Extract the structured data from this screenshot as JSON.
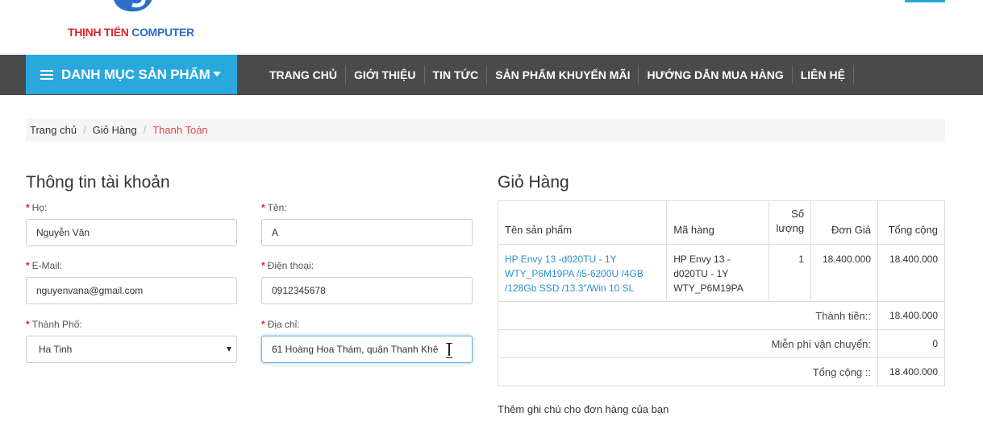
{
  "header": {
    "logo_text_1": "THỊNH TIẾN",
    "logo_text_2": "COMPUTER"
  },
  "nav": {
    "category_label": "DANH MỤC SẢN PHẨM",
    "menu": [
      "TRANG CHỦ",
      "GIỚI THIỆU",
      "TIN TỨC",
      "SẢN PHẨM KHUYẾN MÃI",
      "HƯỚNG DẪN MUA HÀNG",
      "LIÊN HỆ"
    ]
  },
  "breadcrumb": {
    "home": "Trang chủ",
    "cart": "Giỏ Hàng",
    "current": "Thanh Toán"
  },
  "account": {
    "title": "Thông tin tài khoản",
    "required_mark": "*",
    "last_name_label": "Họ:",
    "last_name_value": "Nguyễn Văn",
    "first_name_label": "Tên:",
    "first_name_value": "A",
    "email_label": "E-Mail:",
    "email_value": "nguyenvana@gmail.com",
    "phone_label": "Điện thoại:",
    "phone_value": "0912345678",
    "city_label": "Thành Phố:",
    "city_value": "Ha Tinh",
    "address_label": "Địa chỉ:",
    "address_value": "61 Hoàng Hoa Thám, quận Thanh Khê"
  },
  "cart": {
    "title": "Giỏ Hàng",
    "headers": {
      "name": "Tên sản phẩm",
      "code": "Mã hàng",
      "qty_line1": "Số",
      "qty_line2": "lượng",
      "price": "Đơn Giá",
      "total": "Tổng cộng"
    },
    "items": [
      {
        "name": "HP Envy 13 -d020TU - 1Y WTY_P6M19PA /i5-6200U /4GB /128Gb SSD /13.3\"/Win 10 SL",
        "code": "HP Envy 13 - d020TU - 1Y WTY_P6M19PA",
        "qty": "1",
        "price": "18.400.000",
        "total": "18.400.000"
      }
    ],
    "subtotal_label": "Thành tiền::",
    "subtotal_value": "18.400.000",
    "shipping_label": "Miễn phí vận chuyển:",
    "shipping_value": "0",
    "grand_total_label": "Tổng cộng ::",
    "grand_total_value": "18.400.000",
    "note_label": "Thêm ghi chú cho đơn hàng của bạn"
  },
  "colors": {
    "accent": "#29a8dd",
    "nav_bg": "#4a4a4a",
    "required": "#d9242a",
    "link": "#2a8fd0"
  }
}
